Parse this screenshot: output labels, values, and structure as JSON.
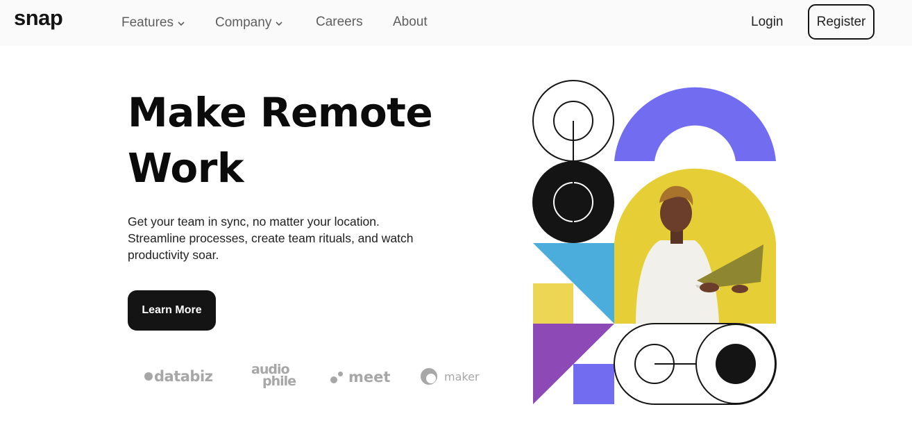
{
  "header": {
    "logo": "snap",
    "nav": [
      {
        "label": "Features",
        "has_dropdown": true
      },
      {
        "label": "Company",
        "has_dropdown": true
      },
      {
        "label": "Careers",
        "has_dropdown": false
      },
      {
        "label": "About",
        "has_dropdown": false
      }
    ],
    "login_label": "Login",
    "register_label": "Register"
  },
  "hero": {
    "title_line1": "Make Remote",
    "title_line2": "Work",
    "description_line1": "Get your team in sync, no matter your location.",
    "description_line2": "Streamline processes, create team rituals, and watch",
    "description_line3": "productivity soar.",
    "cta_label": "Learn More"
  },
  "clients": {
    "databiz": "databiz",
    "audiophile_top": "audio",
    "audiophile_bottom": "phile",
    "meet": "meet",
    "maker": "maker"
  },
  "colors": {
    "purple": "#726cf0",
    "yellow": "#e7d23b",
    "blue": "#4aaddb",
    "violet": "#8d4ab6",
    "dark": "#141414",
    "pale_yellow": "#edd654"
  },
  "icons": [
    "chevron-down-icon"
  ]
}
